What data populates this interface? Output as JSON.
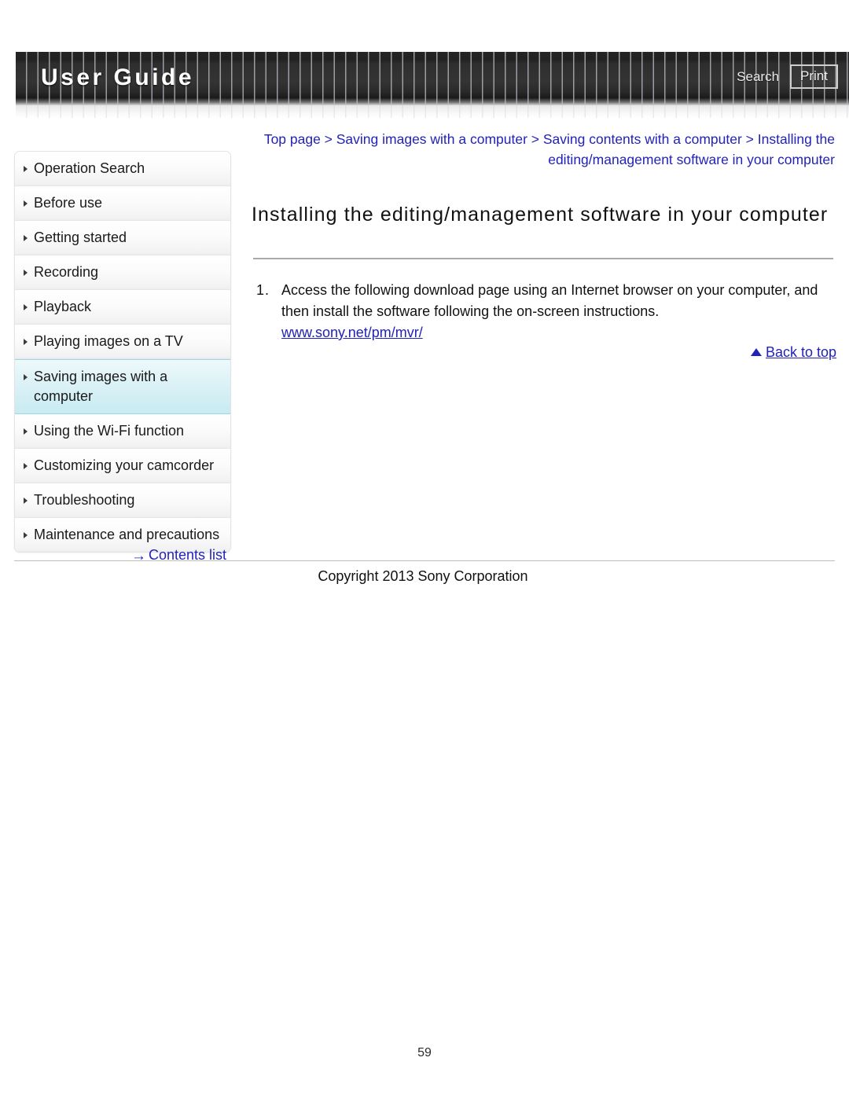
{
  "header": {
    "title": "User Guide",
    "search_label": "Search",
    "print_label": "Print"
  },
  "sidebar": {
    "items": [
      {
        "label": "Operation Search",
        "selected": false
      },
      {
        "label": "Before use",
        "selected": false
      },
      {
        "label": "Getting started",
        "selected": false
      },
      {
        "label": "Recording",
        "selected": false
      },
      {
        "label": "Playback",
        "selected": false
      },
      {
        "label": "Playing images on a TV",
        "selected": false
      },
      {
        "label": "Saving images with a computer",
        "selected": true
      },
      {
        "label": "Using the Wi-Fi function",
        "selected": false
      },
      {
        "label": "Customizing your camcorder",
        "selected": false
      },
      {
        "label": "Troubleshooting",
        "selected": false
      },
      {
        "label": "Maintenance and precautions",
        "selected": false
      }
    ],
    "contents_list_label": "Contents list",
    "contents_list_arrow": "→"
  },
  "main": {
    "breadcrumb": "Top page > Saving images with a computer > Saving contents with a computer > Installing the editing/management software in your computer",
    "page_title": "Installing the editing/management software in your computer",
    "step_number": "1.",
    "step_text": "Access the following download page using an Internet browser on your computer, and then install the software following the on-screen instructions.",
    "step_url": "www.sony.net/pm/mvr/",
    "back_to_top_label": "Back to top"
  },
  "footer": {
    "copyright": "Copyright 2013 Sony Corporation",
    "page_number": "59"
  },
  "colors": {
    "link": "#2222bb",
    "header_bg_dark": "#2e2e2e",
    "selected_nav": "#c8ebf2",
    "rule_gray": "#a9a9a9"
  }
}
